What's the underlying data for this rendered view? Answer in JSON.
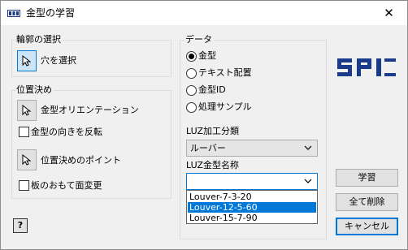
{
  "window": {
    "title": "金型の学習",
    "app_icon": "spi-app-icon",
    "close_glyph": "✕"
  },
  "contour_group": {
    "label": "輪郭の選択",
    "select_hole_label": "穴を選択"
  },
  "positioning_group": {
    "label": "位置決め",
    "die_orientation_label": "金型オリエンテーション",
    "flip_die_label": "金型の向きを反転",
    "positioning_point_label": "位置決めのポイント",
    "sheet_top_label": "板のおもて面変更"
  },
  "data_group": {
    "label": "データ",
    "radios": [
      {
        "label": "金型",
        "checked": true
      },
      {
        "label": "テキスト配置",
        "checked": false
      },
      {
        "label": "金型ID",
        "checked": false
      },
      {
        "label": "処理サンプル",
        "checked": false
      }
    ],
    "luz_class_label": "LUZ加工分類",
    "luz_class_value": "ルーバー",
    "luz_name_label": "LUZ金型名称",
    "luz_name_value": "",
    "luz_name_options": [
      "Louver-7-3-20",
      "Louver-12-5-60",
      "Louver-15-7-90"
    ],
    "luz_name_selected_index": 1
  },
  "buttons": {
    "learn": "学習",
    "delete_all": "全て削除",
    "cancel": "キャンセル",
    "help": "?"
  },
  "logo": {
    "text": "SPI",
    "color": "#1a3a8c"
  },
  "colors": {
    "accent": "#0078d7",
    "selected_bg": "#cce4f7"
  }
}
